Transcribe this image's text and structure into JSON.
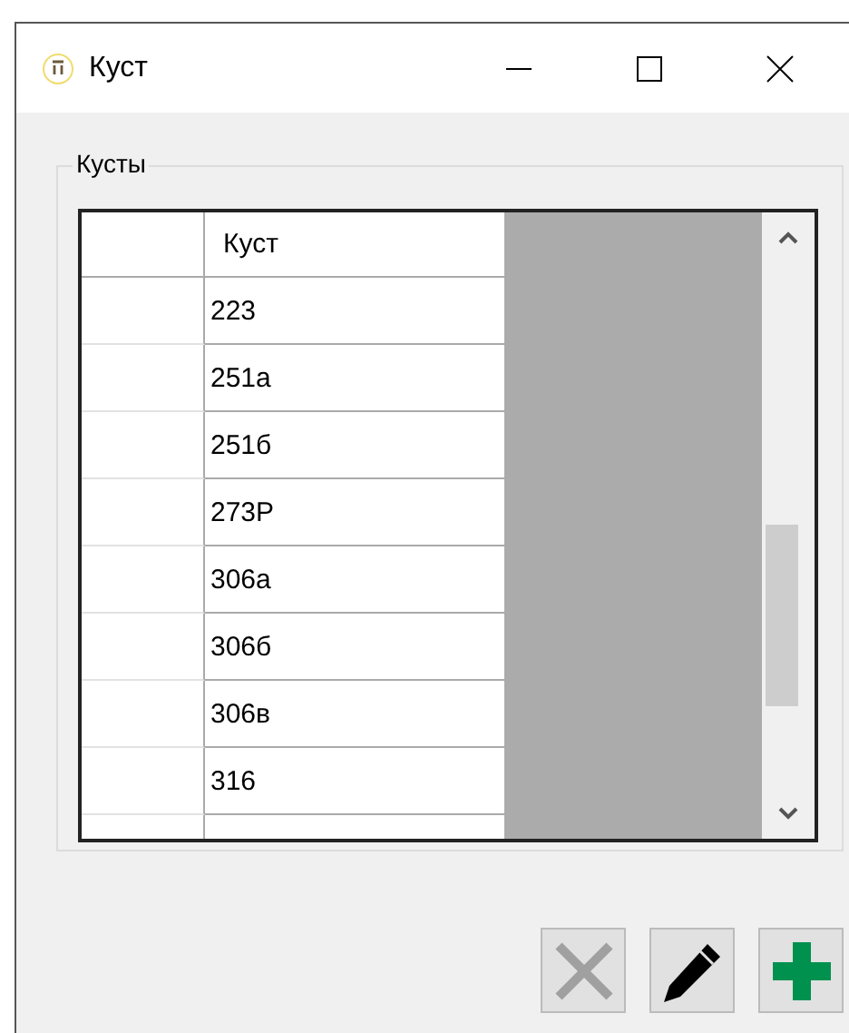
{
  "window": {
    "title": "Куст"
  },
  "group": {
    "title": "Кусты"
  },
  "table": {
    "columns": [
      "Куст"
    ],
    "rows": [
      {
        "cells": [
          "223"
        ]
      },
      {
        "cells": [
          "251а"
        ]
      },
      {
        "cells": [
          "251б"
        ]
      },
      {
        "cells": [
          "273Р"
        ]
      },
      {
        "cells": [
          "306а"
        ]
      },
      {
        "cells": [
          "306б"
        ]
      },
      {
        "cells": [
          "306в"
        ]
      },
      {
        "cells": [
          "316"
        ]
      }
    ]
  },
  "buttons": [
    {
      "kind": "delete",
      "disabled": true
    },
    {
      "kind": "edit",
      "disabled": false
    },
    {
      "kind": "add",
      "disabled": false
    }
  ]
}
